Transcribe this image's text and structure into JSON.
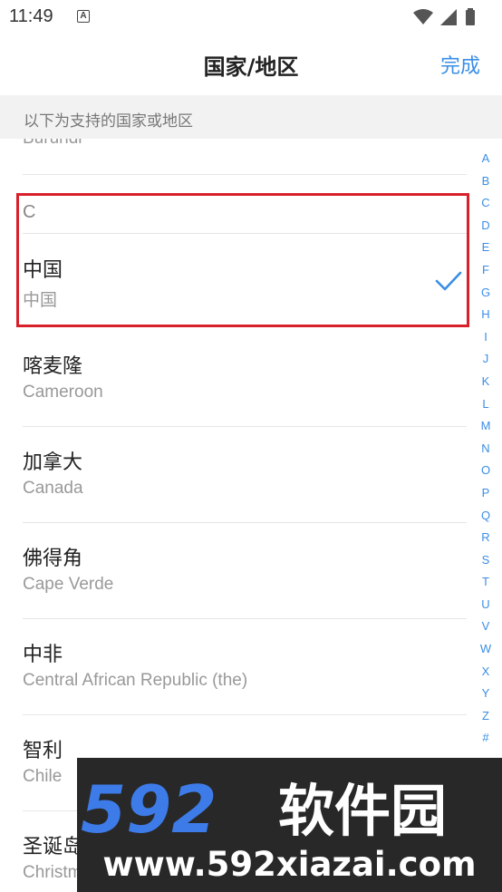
{
  "status_bar": {
    "time": "11:49",
    "notification_glyph": "A",
    "icons": [
      "wifi-icon",
      "cellular-signal-icon",
      "battery-icon"
    ]
  },
  "header": {
    "title": "国家/地区",
    "done_label": "完成",
    "accent_color": "#3a8ee6"
  },
  "subheader": {
    "text": "以下为支持的国家或地区"
  },
  "list": {
    "partial_item_en": "Burundi",
    "section_letter": "C",
    "items": [
      {
        "zh": "中国",
        "en": "中国",
        "selected": true
      },
      {
        "zh": "喀麦隆",
        "en": "Cameroon",
        "selected": false
      },
      {
        "zh": "加拿大",
        "en": "Canada",
        "selected": false
      },
      {
        "zh": "佛得角",
        "en": "Cape Verde",
        "selected": false
      },
      {
        "zh": "中非",
        "en": "Central African Republic (the)",
        "selected": false
      },
      {
        "zh": "智利",
        "en": "Chile",
        "selected": false
      },
      {
        "zh": "圣诞岛",
        "en": "Christmas Island",
        "selected": false
      }
    ]
  },
  "alphabet_index": [
    "A",
    "B",
    "C",
    "D",
    "E",
    "F",
    "G",
    "H",
    "I",
    "J",
    "K",
    "L",
    "M",
    "N",
    "O",
    "P",
    "Q",
    "R",
    "S",
    "T",
    "U",
    "V",
    "W",
    "X",
    "Y",
    "Z",
    "#"
  ],
  "highlight_color": "#d9202a",
  "watermark": {
    "number": "592",
    "brand_cn": "软件园",
    "url": "www.592xiazai.com",
    "number_color": "#3d7be8"
  }
}
